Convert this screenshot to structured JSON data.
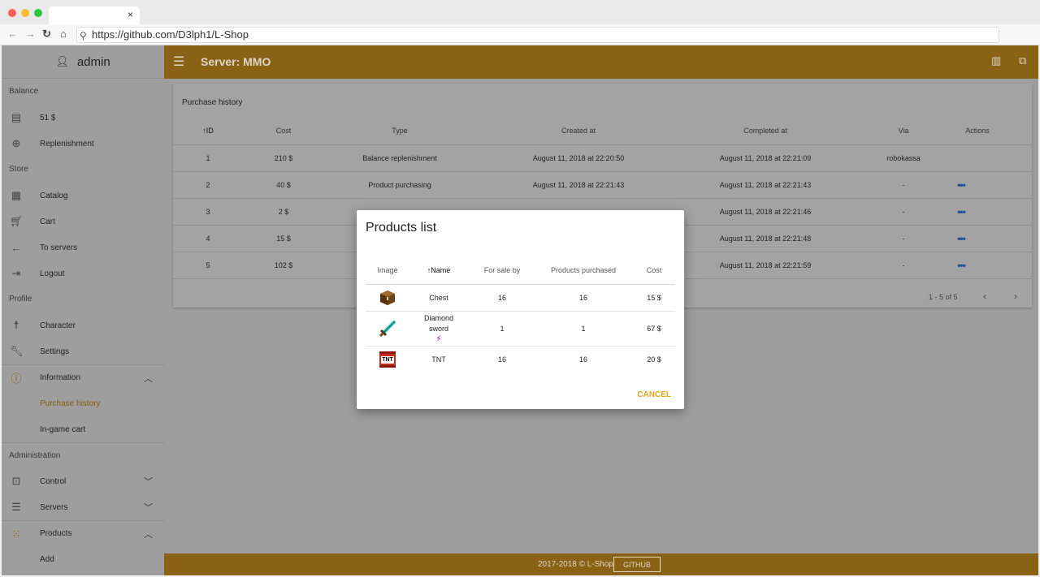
{
  "browser": {
    "url": "https://github.com/D3lph1/L-Shop",
    "tab_close": "×",
    "dots": [
      "#ff5f57",
      "#febc2e",
      "#28c840"
    ]
  },
  "sidebar": {
    "user": "admin",
    "sections": {
      "balance": "Balance",
      "store": "Store",
      "profile": "Profile",
      "administration": "Administration"
    },
    "items": {
      "balance_value": "51 $",
      "replenishment": "Replenishment",
      "catalog": "Catalog",
      "cart": "Cart",
      "to_servers": "To servers",
      "logout": "Logout",
      "character": "Character",
      "settings": "Settings",
      "information": "Information",
      "purchase_history": "Purchase history",
      "ingame_cart": "In-game cart",
      "control": "Control",
      "servers": "Servers",
      "products": "Products",
      "add": "Add"
    }
  },
  "topbar": {
    "title": "Server: MMO"
  },
  "purchase_history": {
    "title": "Purchase history",
    "columns": [
      "ID",
      "Cost",
      "Type",
      "Created at",
      "Completed at",
      "Via",
      "Actions"
    ],
    "sort_arrow": "↑",
    "rows": [
      {
        "id": "1",
        "cost": "210 $",
        "type": "Balance replenishment",
        "created": "August 11, 2018 at 22:20:50",
        "completed": "August 11, 2018 at 22:21:09",
        "via": "robokassa",
        "actions": ""
      },
      {
        "id": "2",
        "cost": "40 $",
        "type": "Product purchasing",
        "created": "August 11, 2018 at 22:21:43",
        "completed": "August 11, 2018 at 22:21:43",
        "via": "-",
        "actions": "•••"
      },
      {
        "id": "3",
        "cost": "2 $",
        "type": "",
        "created": "",
        "completed": "August 11, 2018 at 22:21:46",
        "via": "-",
        "actions": "•••"
      },
      {
        "id": "4",
        "cost": "15 $",
        "type": "",
        "created": "",
        "completed": "August 11, 2018 at 22:21:48",
        "via": "-",
        "actions": "•••"
      },
      {
        "id": "5",
        "cost": "102 $",
        "type": "",
        "created": "",
        "completed": "August 11, 2018 at 22:21:59",
        "via": "-",
        "actions": "•••"
      }
    ],
    "pagination": "1 - 5 of 5"
  },
  "dialog": {
    "title": "Products list",
    "columns": [
      "Image",
      "Name",
      "For sale by",
      "Products purchased",
      "Cost"
    ],
    "sort_arrow": "↑",
    "rows": [
      {
        "name": "Chest",
        "for_sale_by": "16",
        "purchased": "16",
        "cost": "15 $"
      },
      {
        "name": "Diamond sword",
        "for_sale_by": "1",
        "purchased": "1",
        "cost": "67 $"
      },
      {
        "name": "TNT",
        "for_sale_by": "16",
        "purchased": "16",
        "cost": "20 $"
      }
    ],
    "tnt_label": "TNT",
    "cancel": "CANCEL"
  },
  "footer": {
    "text": "2017-2018 © L-Shop",
    "button": "GITHUB"
  }
}
